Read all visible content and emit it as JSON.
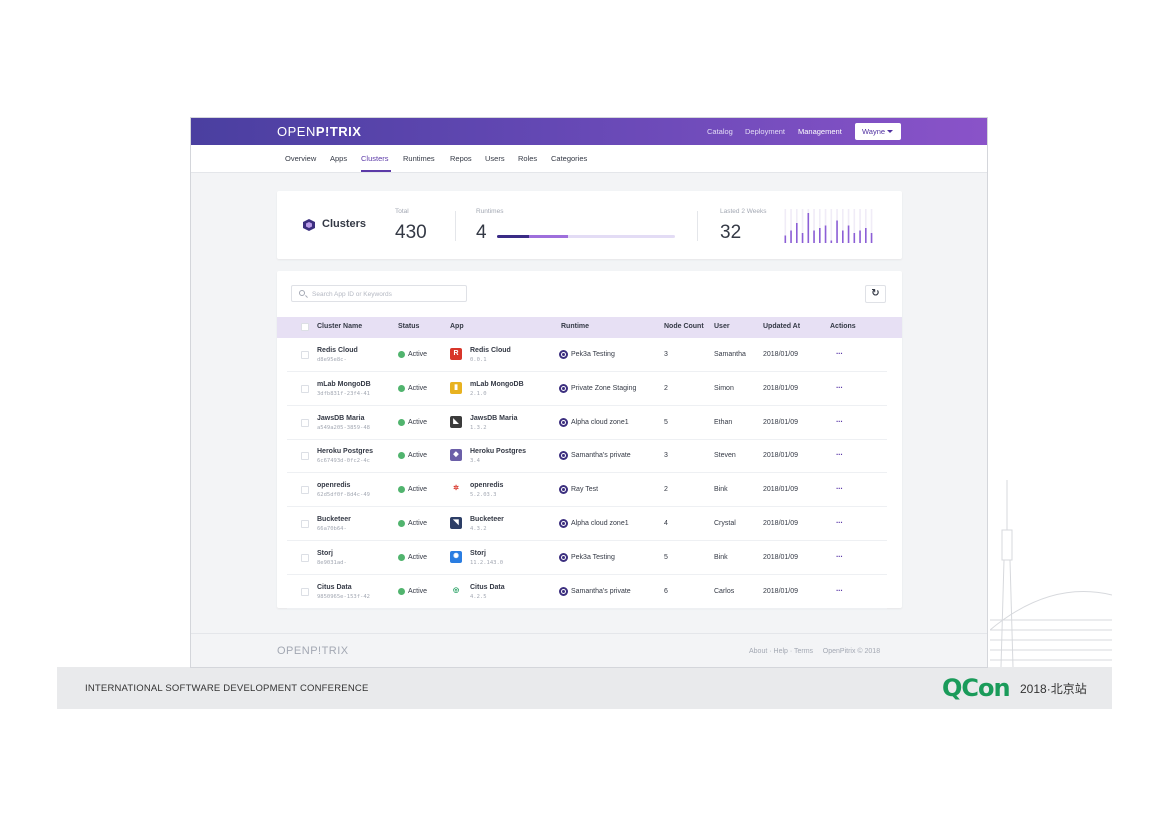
{
  "conference": {
    "title": "INTERNATIONAL SOFTWARE DEVELOPMENT CONFERENCE",
    "brand": "QCon",
    "edition": "2018·北京站"
  },
  "app": {
    "logo_light": "OPEN",
    "logo_bold": "P!TRIX",
    "topnav": [
      "Catalog",
      "Deployment",
      "Management"
    ],
    "user": "Wayne",
    "subnav": [
      "Overview",
      "Apps",
      "Clusters",
      "Runtimes",
      "Repos",
      "Users",
      "Roles",
      "Categories"
    ],
    "subnav_active": "Clusters"
  },
  "stats": {
    "title": "Clusters",
    "total_label": "Total",
    "total": "430",
    "runtimes_label": "Runtimes",
    "runtimes": "4",
    "runtimes_progress": 0.4,
    "last_label": "Lasted 2 Weeks",
    "last": "32",
    "sparkline": [
      3,
      5,
      8,
      4,
      12,
      5,
      6,
      7,
      1,
      9,
      5,
      7,
      4,
      5,
      6,
      4
    ]
  },
  "table": {
    "search_placeholder": "Search App ID or Keywords",
    "refresh_icon": "refresh-icon",
    "columns": [
      "Cluster Name",
      "Status",
      "App",
      "Runtime",
      "Node Count",
      "User",
      "Updated At",
      "Actions"
    ],
    "rows": [
      {
        "name": "Redis Cloud",
        "id": "d8e95e8c-",
        "status": "Active",
        "app": "Redis Cloud",
        "version": "0.0.1",
        "app_color": "#d8362a",
        "app_glyph": "R",
        "runtime": "Pek3a Testing",
        "nodes": "3",
        "user": "Samantha",
        "updated": "2018/01/09",
        "actions": "···"
      },
      {
        "name": "mLab MongoDB",
        "id": "3dfb831f-23f4-41",
        "status": "Active",
        "app": "mLab MongoDB",
        "version": "2.1.0",
        "app_color": "#e8b220",
        "app_glyph": "▮",
        "runtime": "Private Zone Staging",
        "nodes": "2",
        "user": "Simon",
        "updated": "2018/01/09",
        "actions": "···"
      },
      {
        "name": "JawsDB Maria",
        "id": "a549a205-3859-48",
        "status": "Active",
        "app": "JawsDB Maria",
        "version": "1.3.2",
        "app_color": "#3b3b3b",
        "app_glyph": "◣",
        "runtime": "Alpha cloud zone1",
        "nodes": "5",
        "user": "Ethan",
        "updated": "2018/01/09",
        "actions": "···"
      },
      {
        "name": "Heroku Postgres",
        "id": "6c67493d-0fc2-4c",
        "status": "Active",
        "app": "Heroku Postgres",
        "version": "3.4",
        "app_color": "#6b5fa8",
        "app_glyph": "◆",
        "runtime": "Samantha's private",
        "nodes": "3",
        "user": "Steven",
        "updated": "2018/01/09",
        "actions": "···"
      },
      {
        "name": "openredis",
        "id": "62d5df0f-8d4c-49",
        "status": "Active",
        "app": "openredis",
        "version": "5.2.03.3",
        "app_color": "#ffffff",
        "app_glyph": "✲",
        "runtime": "Ray Test",
        "nodes": "2",
        "user": "Bink",
        "updated": "2018/01/09",
        "actions": "···"
      },
      {
        "name": "Bucketeer",
        "id": "66a70b64-",
        "status": "Active",
        "app": "Bucketeer",
        "version": "4.3.2",
        "app_color": "#2c3e66",
        "app_glyph": "◥",
        "runtime": "Alpha cloud zone1",
        "nodes": "4",
        "user": "Crystal",
        "updated": "2018/01/09",
        "actions": "···"
      },
      {
        "name": "Storj",
        "id": "8e9031ad-",
        "status": "Active",
        "app": "Storj",
        "version": "11.2.143.0",
        "app_color": "#2a7de1",
        "app_glyph": "✺",
        "runtime": "Pek3a Testing",
        "nodes": "5",
        "user": "Bink",
        "updated": "2018/01/09",
        "actions": "···"
      },
      {
        "name": "Citus Data",
        "id": "9850965e-153f-42",
        "status": "Active",
        "app": "Citus Data",
        "version": "4.2.5",
        "app_color": "#ffffff",
        "app_glyph": "◎",
        "runtime": "Samantha's private",
        "nodes": "6",
        "user": "Carlos",
        "updated": "2018/01/09",
        "actions": "···"
      }
    ]
  },
  "footer": {
    "logo_light": "OPEN",
    "logo_bold": "P!TRIX",
    "links": "About · Help · Terms     OpenPitrix © 2018"
  },
  "colors": {
    "brand_purple": "#5c3aa8",
    "header_gradient_start": "#4a3fa0",
    "header_gradient_end": "#8a53c9",
    "status_active": "#51b46e",
    "qcon_green": "#1a9b5a"
  }
}
